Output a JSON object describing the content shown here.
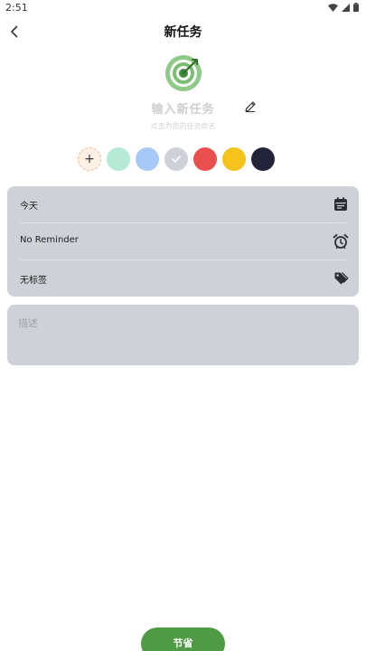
{
  "status_bar": {
    "time": "2:51"
  },
  "header": {
    "title": "新任务"
  },
  "task": {
    "name_placeholder": "输入新任务",
    "hint": "点击为您的任务命名"
  },
  "colors": {
    "add_label": "+",
    "swatches": [
      "#b6ead6",
      "#a6c9f7",
      "#cfd1d8",
      "#ea5050",
      "#f5c31c",
      "#22253a"
    ],
    "selected": "#cfd1d8"
  },
  "settings": {
    "date_label": "今天",
    "reminder_label": "No Reminder",
    "tag_label": "无标签"
  },
  "description": {
    "placeholder": "描述"
  },
  "save_label": "节省",
  "accent": "#4f9a45"
}
